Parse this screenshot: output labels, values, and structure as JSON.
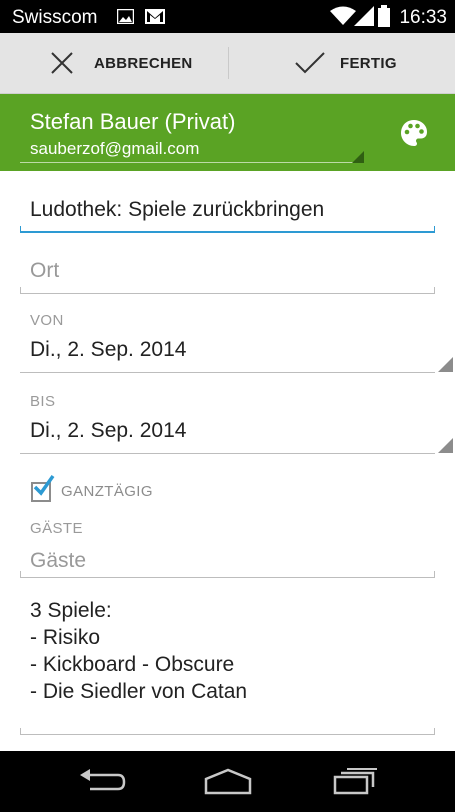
{
  "status_bar": {
    "carrier": "Swisscom",
    "time": "16:33",
    "icons": [
      "image-notification-icon",
      "gmail-icon",
      "wifi-icon",
      "signal-icon",
      "battery-icon"
    ]
  },
  "action_bar": {
    "cancel_label": "ABBRECHEN",
    "done_label": "FERTIG"
  },
  "account": {
    "name": "Stefan Bauer (Privat)",
    "email": "sauberzof@gmail.com",
    "color": "#5aa324"
  },
  "event": {
    "title": "Ludothek: Spiele zurückbringen",
    "location_placeholder": "Ort",
    "from_label": "VON",
    "from_date": "Di., 2. Sep. 2014",
    "to_label": "BIS",
    "to_date": "Di., 2. Sep. 2014",
    "all_day_label": "GANZTÄGIG",
    "all_day_checked": true,
    "guests_label": "GÄSTE",
    "guests_placeholder": "Gäste",
    "description_lines": [
      "3 Spiele:",
      "- Risiko",
      "- Kickboard - Obscure",
      "- Die Siedler von Catan"
    ]
  },
  "nav_bar": {
    "icons": [
      "back-icon",
      "home-icon",
      "recents-icon"
    ]
  }
}
